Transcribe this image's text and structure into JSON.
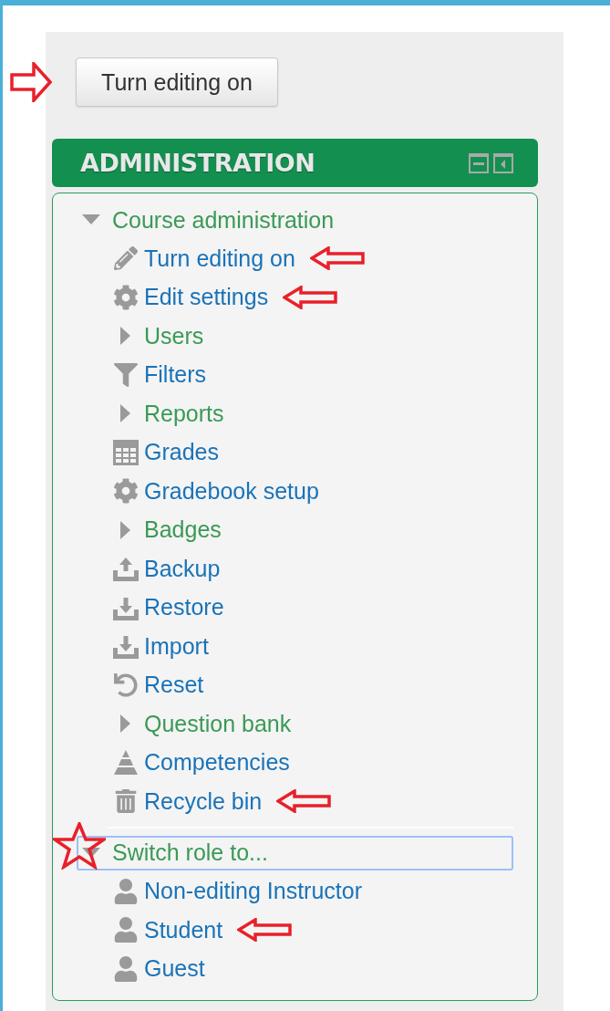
{
  "edit_button": {
    "label": "Turn editing on",
    "marked": true
  },
  "block": {
    "title": "ADMINISTRATION",
    "groups": [
      {
        "label": "Course administration",
        "expanded": true,
        "focused": false,
        "marked": false,
        "items": [
          {
            "kind": "link",
            "label": "Turn editing on",
            "marked": true
          },
          {
            "kind": "link",
            "label": "Edit settings",
            "marked": true
          },
          {
            "kind": "branch",
            "label": "Users",
            "marked": false
          },
          {
            "kind": "link",
            "label": "Filters",
            "marked": false
          },
          {
            "kind": "branch",
            "label": "Reports",
            "marked": false
          },
          {
            "kind": "link",
            "label": "Grades",
            "marked": false
          },
          {
            "kind": "link",
            "label": "Gradebook setup",
            "marked": false
          },
          {
            "kind": "branch",
            "label": "Badges",
            "marked": false
          },
          {
            "kind": "link",
            "label": "Backup",
            "marked": false
          },
          {
            "kind": "link",
            "label": "Restore",
            "marked": false
          },
          {
            "kind": "link",
            "label": "Import",
            "marked": false
          },
          {
            "kind": "link",
            "label": "Reset",
            "marked": false
          },
          {
            "kind": "branch",
            "label": "Question bank",
            "marked": false
          },
          {
            "kind": "link",
            "label": "Competencies",
            "marked": false
          },
          {
            "kind": "link",
            "label": "Recycle bin",
            "marked": true
          }
        ]
      },
      {
        "label": "Switch role to...",
        "expanded": true,
        "focused": true,
        "marked": true,
        "items": [
          {
            "kind": "link",
            "label": "Non-editing Instructor",
            "marked": false
          },
          {
            "kind": "link",
            "label": "Student",
            "marked": true
          },
          {
            "kind": "link",
            "label": "Guest",
            "marked": false
          }
        ]
      }
    ]
  }
}
